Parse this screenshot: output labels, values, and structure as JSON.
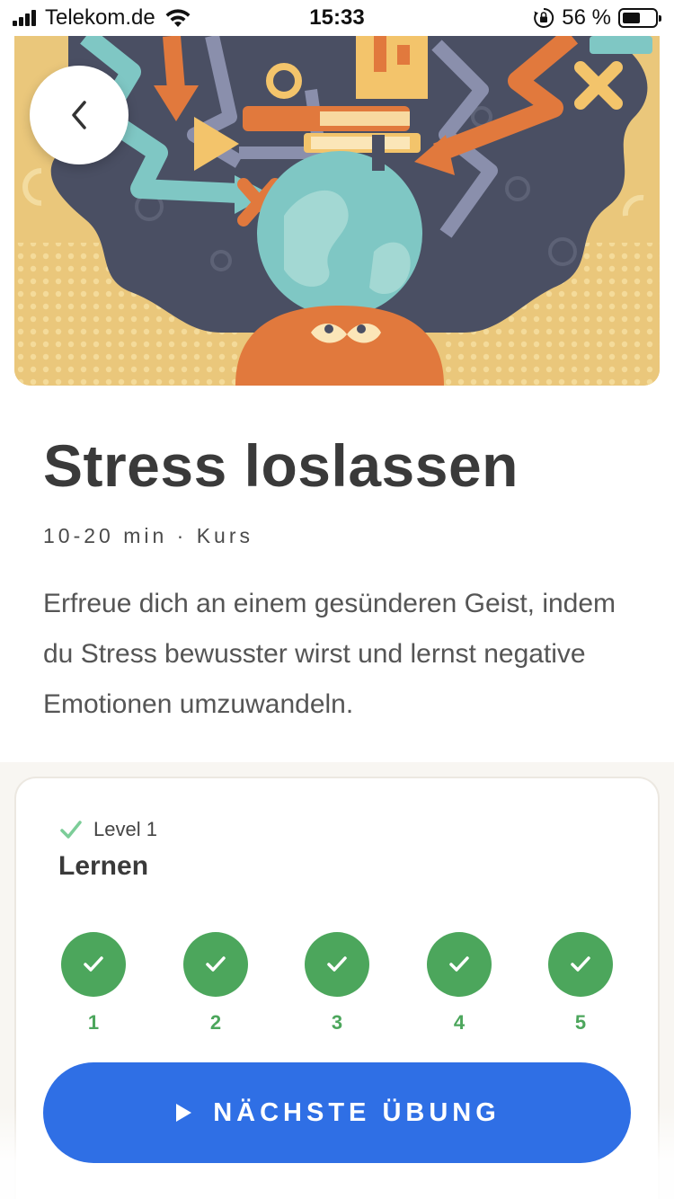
{
  "status_bar": {
    "carrier": "Telekom.de",
    "time": "15:33",
    "battery_percent": "56 %",
    "battery_level": 0.56,
    "icons": [
      "signal-icon",
      "wifi-icon",
      "orientation-lock-icon",
      "battery-icon"
    ]
  },
  "hero": {
    "image": "stress-illustration",
    "back_icon": "chevron-left-icon"
  },
  "course": {
    "title": "Stress loslassen",
    "meta": "10-20 min · Kurs",
    "description": "Erfreue dich an einem gesünderen Geist, indem du Stress bewusster wirst und lernst negative Emotionen umzuwandeln."
  },
  "level_card": {
    "level_label": "Level 1",
    "title": "Lernen",
    "steps": [
      {
        "number": "1",
        "completed": true
      },
      {
        "number": "2",
        "completed": true
      },
      {
        "number": "3",
        "completed": true
      },
      {
        "number": "4",
        "completed": true
      },
      {
        "number": "5",
        "completed": true
      }
    ]
  },
  "cta": {
    "label": "NÄCHSTE ÜBUNG",
    "icon": "play-icon"
  },
  "colors": {
    "accent_blue": "#2f6fe5",
    "success_green": "#4ca65c",
    "hero_yellow": "#eac77b",
    "hero_dark": "#4a4f63"
  }
}
